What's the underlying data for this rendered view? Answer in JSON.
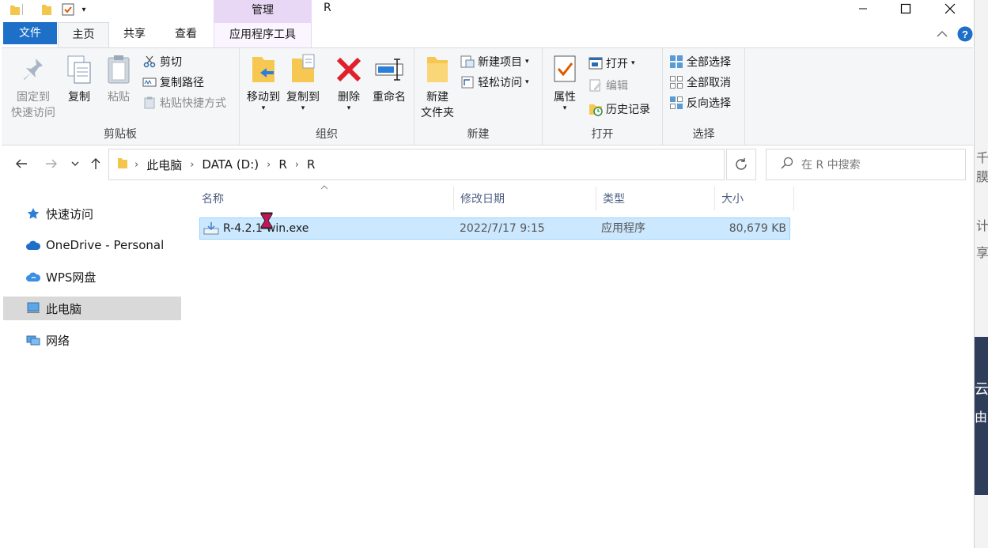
{
  "window": {
    "title": "R",
    "contextual_tab": "管理"
  },
  "tabs": {
    "file": "文件",
    "home": "主页",
    "share": "共享",
    "view": "查看",
    "app_tools": "应用程序工具"
  },
  "ribbon": {
    "clipboard": {
      "title": "剪贴板",
      "pin_line1": "固定到",
      "pin_line2": "快速访问",
      "copy": "复制",
      "paste": "粘贴",
      "cut": "剪切",
      "copy_path": "复制路径",
      "paste_shortcut": "粘贴快捷方式"
    },
    "organize": {
      "title": "组织",
      "move_to": "移动到",
      "copy_to": "复制到",
      "delete": "删除",
      "rename": "重命名"
    },
    "new": {
      "title": "新建",
      "new_folder_line1": "新建",
      "new_folder_line2": "文件夹",
      "new_item": "新建项目",
      "easy_access": "轻松访问"
    },
    "open": {
      "title": "打开",
      "properties": "属性",
      "open": "打开",
      "edit": "编辑",
      "history": "历史记录"
    },
    "select": {
      "title": "选择",
      "select_all": "全部选择",
      "select_none": "全部取消",
      "invert": "反向选择"
    }
  },
  "address": {
    "crumbs": [
      "此电脑",
      "DATA (D:)",
      "R",
      "R"
    ],
    "search_placeholder": "在 R 中搜索"
  },
  "nav_pane": {
    "items": [
      {
        "label": "快速访问",
        "icon": "star-icon"
      },
      {
        "label": "OneDrive - Personal",
        "icon": "cloud-icon"
      },
      {
        "label": "WPS网盘",
        "icon": "cloud-icon"
      },
      {
        "label": "此电脑",
        "icon": "computer-icon",
        "selected": true
      },
      {
        "label": "网络",
        "icon": "network-icon"
      }
    ]
  },
  "columns": {
    "name": "名称",
    "date": "修改日期",
    "type": "类型",
    "size": "大小"
  },
  "files": [
    {
      "name": "R-4.2.1-win.exe",
      "date": "2022/7/17 9:15",
      "type": "应用程序",
      "size": "80,679 KB",
      "selected": true
    }
  ],
  "background_window": {
    "fragments": [
      "千膜",
      "计",
      "享"
    ],
    "dark_fragments": [
      "云",
      "由"
    ]
  },
  "colors": {
    "accent": "#1e6fc7",
    "manage_tab": "#e8d7f5",
    "selection": "#cce8ff"
  }
}
